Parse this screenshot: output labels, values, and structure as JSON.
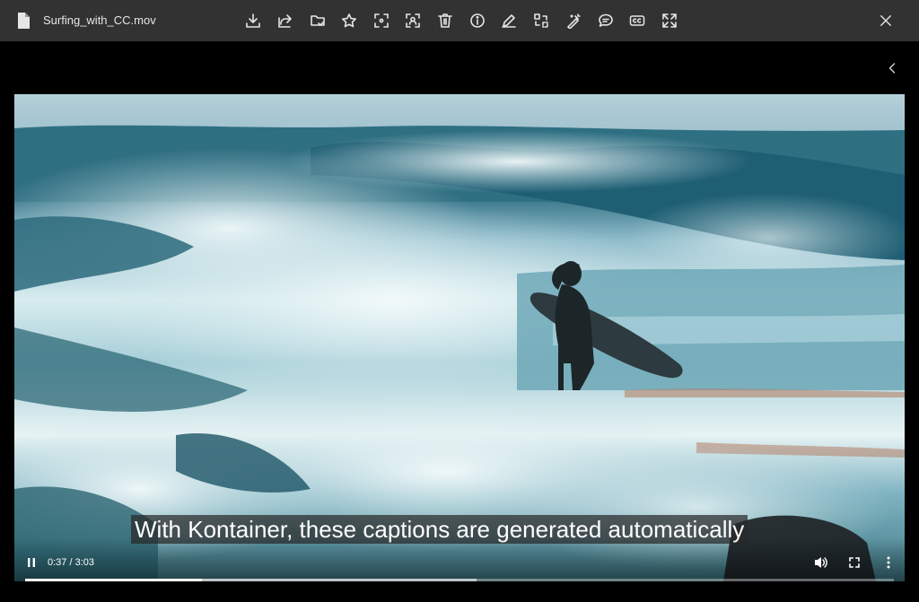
{
  "header": {
    "file_name": "Surfing_with_CC.mov",
    "toolbar_icons": [
      "download-icon",
      "share-icon",
      "move-to-folder-icon",
      "favorite-star-icon",
      "crop-icon",
      "face-detect-icon",
      "delete-icon",
      "info-icon",
      "edit-pencil-icon",
      "replace-icon",
      "magic-wand-icon",
      "comment-icon",
      "closed-captions-icon",
      "expand-icon"
    ],
    "close_icon": "close-icon"
  },
  "video": {
    "caption": "With Kontainer, these captions are generated automatically",
    "time_display": "0:37 / 3:03",
    "progress_fraction": 0.204,
    "buffered_fraction": 0.52,
    "state": "playing"
  },
  "colors": {
    "toolbar_bg": "#323232",
    "page_bg": "#000000",
    "icon": "#e6e6e6"
  }
}
